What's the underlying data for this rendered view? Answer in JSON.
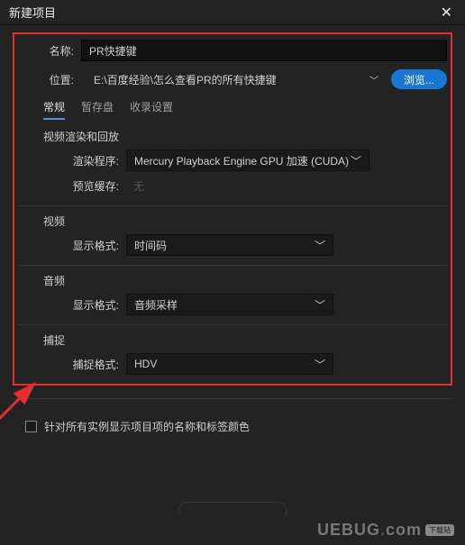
{
  "window": {
    "title": "新建项目"
  },
  "fields": {
    "name_label": "名称:",
    "name_value": "PR快捷键",
    "location_label": "位置:",
    "location_value": "E:\\百度经验\\怎么查看PR的所有快捷键",
    "browse": "浏览..."
  },
  "tabs": {
    "general": "常规",
    "scratch": "暂存盘",
    "ingest": "收录设置"
  },
  "render": {
    "section": "视频渲染和回放",
    "renderer_label": "渲染程序:",
    "renderer_value": "Mercury Playback Engine GPU 加速 (CUDA)",
    "preview_label": "预览缓存:",
    "preview_value": "无"
  },
  "video": {
    "section": "视频",
    "format_label": "显示格式:",
    "format_value": "时间码"
  },
  "audio": {
    "section": "音频",
    "format_label": "显示格式:",
    "format_value": "音频采样"
  },
  "capture": {
    "section": "捕捉",
    "format_label": "捕捉格式:",
    "format_value": "HDV"
  },
  "checkbox": {
    "label": "针对所有实例显示项目项的名称和标签颜色"
  },
  "watermark": {
    "a": "UEBUG",
    "b": "com",
    "badge": "下载站"
  }
}
